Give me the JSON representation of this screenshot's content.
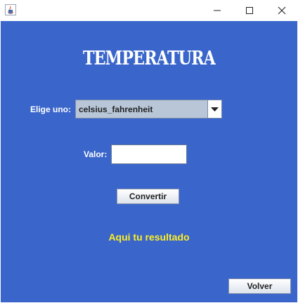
{
  "window": {
    "app_icon": "java-icon",
    "controls": [
      "minimize-icon",
      "maximize-icon",
      "close-icon"
    ]
  },
  "form": {
    "title": "TEMPERATURA",
    "choose_label": "Elige uno:",
    "conversion_selected": "celsius_fahrenheit",
    "value_label": "Valor:",
    "value_input": "",
    "convert_button": "Convertir",
    "result_text": "Aqui tu resultado",
    "back_button": "Volver"
  },
  "colors": {
    "panel_background": "#3a66cc",
    "label_text": "#ffffff",
    "result_text": "#ffee22"
  }
}
